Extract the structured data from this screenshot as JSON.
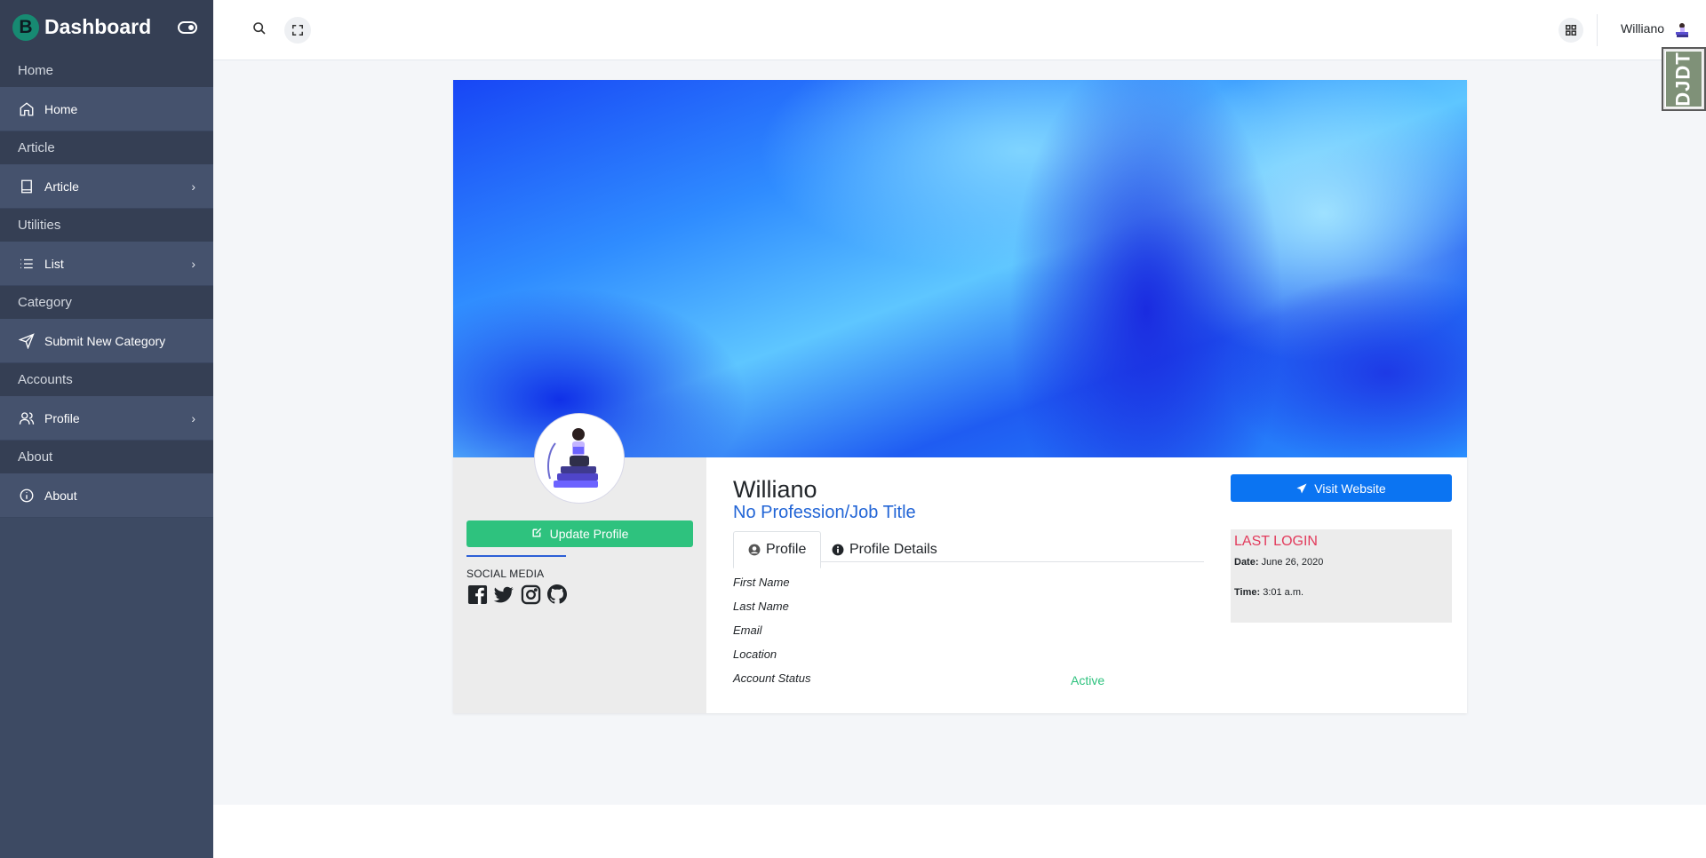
{
  "sidebar": {
    "brand_letter": "B",
    "brand_title": "Dashboard",
    "sections": [
      {
        "header": "Home",
        "item": {
          "label": "Home",
          "icon": "home-icon",
          "has_chevron": false
        }
      },
      {
        "header": "Article",
        "item": {
          "label": "Article",
          "icon": "book-icon",
          "has_chevron": true
        }
      },
      {
        "header": "Utilities",
        "item": {
          "label": "List",
          "icon": "list-icon",
          "has_chevron": true
        }
      },
      {
        "header": "Category",
        "item": {
          "label": "Submit New Category",
          "icon": "send-icon",
          "has_chevron": false
        }
      },
      {
        "header": "Accounts",
        "item": {
          "label": "Profile",
          "icon": "users-icon",
          "has_chevron": true
        }
      },
      {
        "header": "About",
        "item": {
          "label": "About",
          "icon": "info-icon",
          "has_chevron": false
        }
      }
    ]
  },
  "topbar": {
    "username": "Williano"
  },
  "profile": {
    "name": "Williano",
    "title": "No Profession/Job Title",
    "update_button": "Update Profile",
    "social_label": "SOCIAL MEDIA",
    "social_icons": [
      "facebook-icon",
      "twitter-icon",
      "instagram-icon",
      "github-icon"
    ],
    "tabs": [
      "Profile",
      "Profile Details"
    ],
    "fields": [
      "First Name",
      "Last Name",
      "Email",
      "Location",
      "Account Status"
    ],
    "account_status": "Active",
    "visit_button": "Visit Website",
    "last_login": {
      "title": "LAST LOGIN",
      "date_label": "Date:",
      "date_value": "June 26, 2020",
      "time_label": "Time:",
      "time_value": "3:01 a.m."
    }
  },
  "debug_toolbar": {
    "label": "DJDT"
  },
  "colors": {
    "sidebar_bg": "#3d4a63",
    "success": "#2ec27e",
    "primary": "#0b74f2",
    "title_blue": "#2265d6",
    "last_login_red": "#e23b5c"
  }
}
